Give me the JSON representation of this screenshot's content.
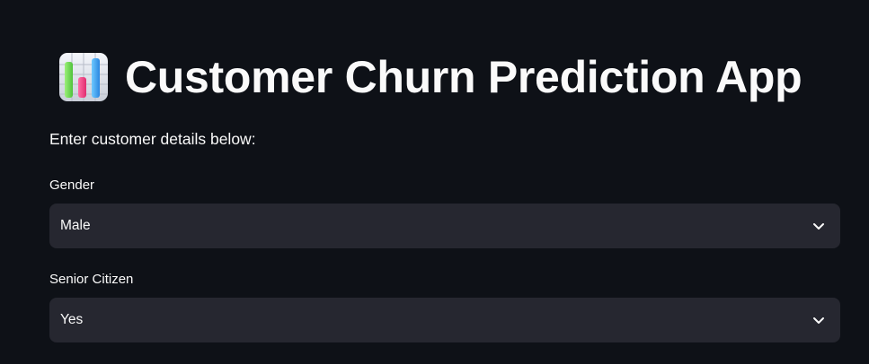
{
  "header": {
    "title": "Customer Churn Prediction App",
    "icon": "bar-chart-emoji-icon"
  },
  "intro_text": "Enter customer details below:",
  "fields": [
    {
      "label": "Gender",
      "value": "Male",
      "icon": "chevron-down-icon"
    },
    {
      "label": "Senior Citizen",
      "value": "Yes",
      "icon": "chevron-down-icon"
    }
  ],
  "colors": {
    "background": "#0e1117",
    "select_background": "#262730",
    "text": "#fafafa"
  }
}
